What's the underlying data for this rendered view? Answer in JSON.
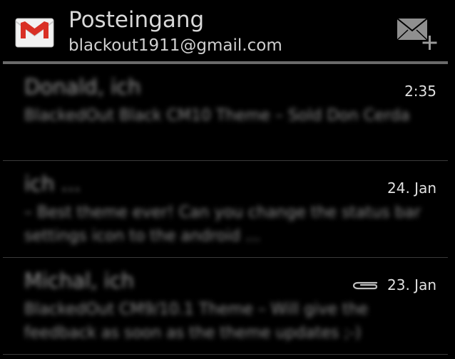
{
  "header": {
    "title": "Posteingang",
    "account": "blackout1911@gmail.com"
  },
  "icons": {
    "logo": "gmail-logo-icon",
    "compose": "compose-mail-icon",
    "attachment": "paperclip-icon"
  },
  "colors": {
    "background": "#000000",
    "gmail_red": "#d93025",
    "divider": "#6a6a6a"
  },
  "messages": [
    {
      "sender": "Donald, ich",
      "snippet": "BlackedOut Black CM10 Theme – Sold Don Cerda",
      "time": "2:35",
      "has_attachment": false
    },
    {
      "sender": "ich ...",
      "snippet": "– Best theme ever! Can you change the status bar settings icon to the android ...",
      "time": "24. Jan",
      "has_attachment": false
    },
    {
      "sender": "Michal, ich",
      "snippet": "BlackedOut CM9/10.1 Theme – Will give the feedback as soon as the theme updates ;-)",
      "time": "23. Jan",
      "has_attachment": true
    }
  ]
}
